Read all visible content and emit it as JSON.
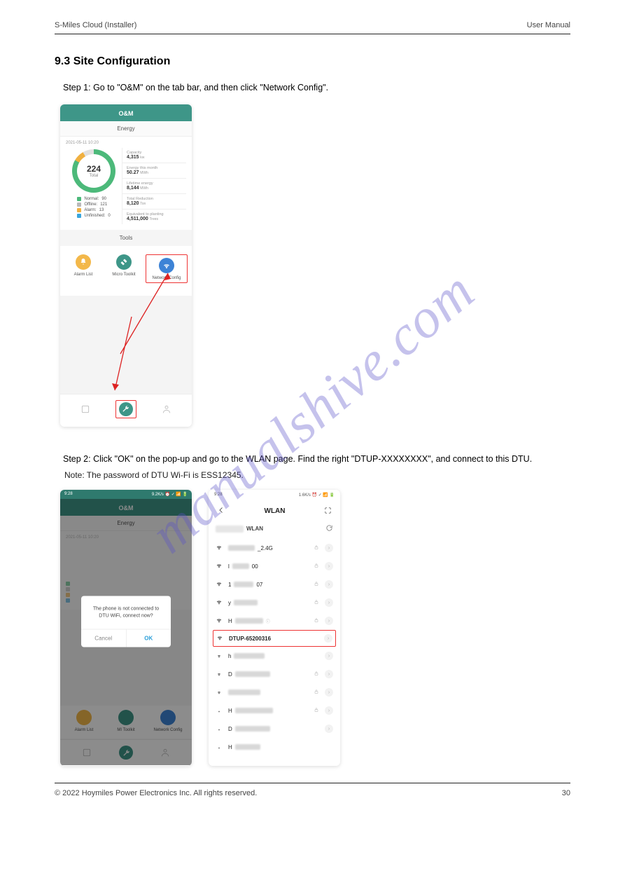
{
  "header": {
    "left": "S-Miles Cloud (Installer)",
    "right": "User Manual"
  },
  "section_title": "9.3 Site Configuration",
  "step1": "Step 1: Go to \"O&M\" on the tab bar, and then click \"Network Config\".",
  "step2": "Step 2: Click \"OK\" on the pop-up and go to the WLAN page. Find the right \"DTUP-XXXXXXXX\", and connect to this DTU.",
  "step2_note": "Note: The password of DTU Wi-Fi is ESS12345.",
  "watermark": "manualshive.com",
  "phone1": {
    "title": "O&M",
    "energy_label": "Energy",
    "date": "2021-05-11 10:20",
    "gauge_value": "224",
    "gauge_total": "Total",
    "stats": [
      {
        "label": "Capacity",
        "value": "4,315",
        "unit": "kw"
      },
      {
        "label": "Energy this month",
        "value": "50.27",
        "unit": "MWh"
      },
      {
        "label": "Lifetime energy",
        "value": "8,144",
        "unit": "MWh"
      },
      {
        "label": "Total Reduction",
        "value": "8,120",
        "unit": "Ton"
      },
      {
        "label": "Equivalent to planting",
        "value": "4,511,000",
        "unit": "Trees"
      }
    ],
    "legend": [
      {
        "color": "green",
        "label": "Normal:",
        "count": "90"
      },
      {
        "color": "grey",
        "label": "Offline:",
        "count": "121"
      },
      {
        "color": "orange",
        "label": "Alarm:",
        "count": "13"
      },
      {
        "color": "blue",
        "label": "Unfinished:",
        "count": "0"
      }
    ],
    "tools_label": "Tools",
    "tools": [
      {
        "name": "Alarm List"
      },
      {
        "name": "Micro Toolkit"
      },
      {
        "name": "Network Config"
      }
    ]
  },
  "phone2": {
    "time": "9:28",
    "status_right": "9.2K/s ⏰ ✓ 📶 🔋",
    "title": "O&M",
    "energy_label": "Energy",
    "dialog_text": "The phone is not connected to DTU WiFi, connect now?",
    "cancel": "Cancel",
    "ok": "OK",
    "tools": [
      "Alarm List",
      "MI Toolkit",
      "Network Config"
    ]
  },
  "phone3": {
    "time": "9:28",
    "status_right": "1.6K/s ⏰ ✓ 📶 🔋",
    "title": "WLAN",
    "header_label": "WLAN",
    "highlight_ssid": "DTUP-65200316",
    "items": [
      {
        "suffix": "_2.4G",
        "lock": true
      },
      {
        "prefix": "l",
        "suffix": "00",
        "lock": true
      },
      {
        "prefix": "1",
        "suffix": "07",
        "lock": true
      },
      {
        "prefix": "y",
        "lock": true
      },
      {
        "prefix": "H",
        "badge": true,
        "lock": true
      },
      {
        "highlight": true
      },
      {
        "prefix": "h"
      },
      {
        "prefix": "D",
        "lock": true
      },
      {
        "prefix": "",
        "lock": true
      },
      {
        "prefix": "H",
        "lock": true
      },
      {
        "prefix": "D"
      },
      {
        "prefix": "H"
      }
    ]
  },
  "footer": {
    "copy": "© 2022 Hoymiles Power Electronics Inc. All rights reserved.",
    "page": "30"
  }
}
